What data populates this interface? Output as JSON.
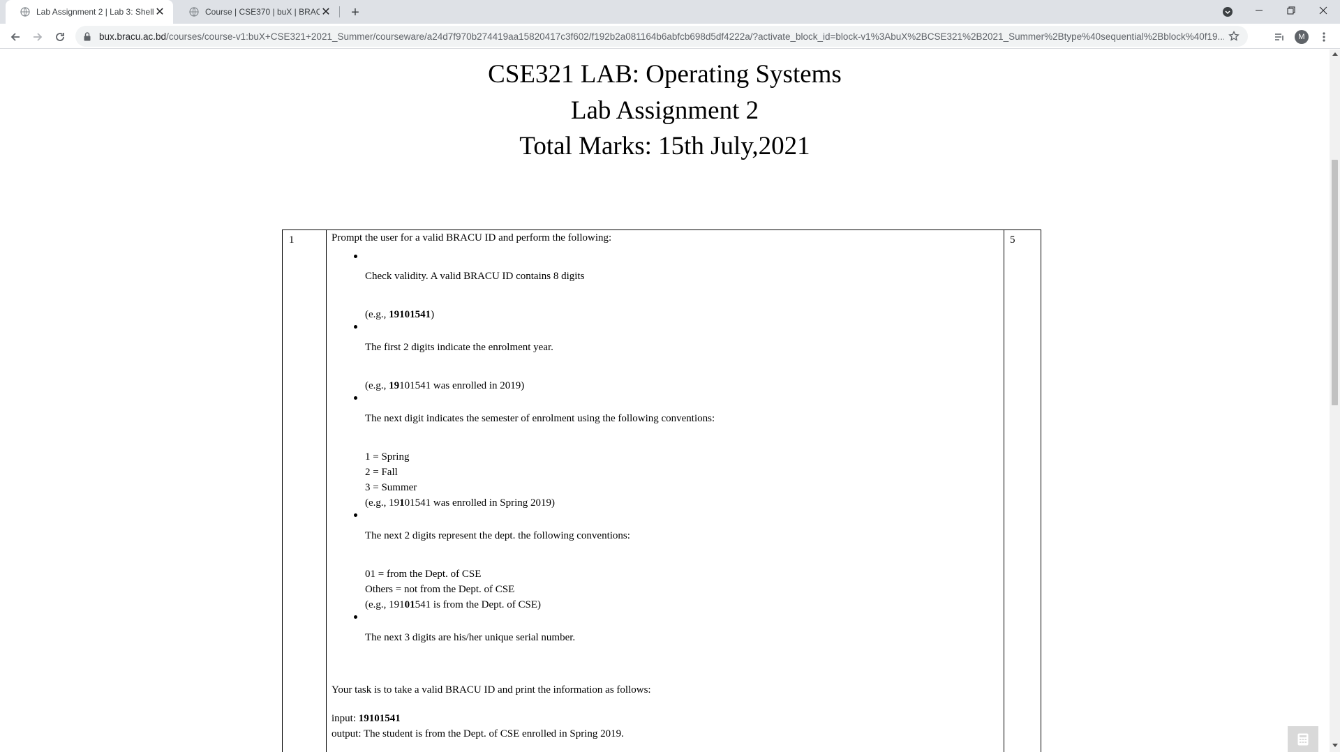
{
  "browser": {
    "tabs": [
      {
        "title": "Lab Assignment 2 | Lab 3: Shell S",
        "active": true
      },
      {
        "title": "Course | CSE370 | buX | BRAC Un",
        "active": false
      }
    ],
    "url_host": "bux.bracu.ac.bd",
    "url_path": "/courses/course-v1:buX+CSE321+2021_Summer/courseware/a24d7f970b274419aa15820417c3f602/f192b2a081164b6abfcb698d5df4222a/?activate_block_id=block-v1%3AbuX%2BCSE321%2B2021_Summer%2Btype%40sequential%2Bblock%40f19...",
    "avatar_letter": "M"
  },
  "document": {
    "title_line1": "CSE321 LAB: Operating Systems",
    "title_line2": "Lab Assignment 2",
    "title_line3": "Total Marks: 15th July,2021"
  },
  "question": {
    "number": "1",
    "marks": "5",
    "prompt": "Prompt the user for a valid BRACU ID and perform the following:",
    "b1_text": "Check validity. A valid BRACU ID contains 8 digits",
    "b1_ex_pre": "(e.g., ",
    "b1_ex_bold": "19101541",
    "b1_ex_post": ")",
    "b2_text": "The first 2 digits indicate the enrolment year.",
    "b2_ex_pre": "(e.g., ",
    "b2_ex_bold": "19",
    "b2_ex_post": "101541 was enrolled in 2019)",
    "b3_text": "The next digit indicates the semester of enrolment using the following conventions:",
    "b3_c1": "1 = Spring",
    "b3_c2": "2 = Fall",
    "b3_c3": "3 = Summer",
    "b3_ex_pre": "(e.g., 19",
    "b3_ex_bold": "1",
    "b3_ex_post": "01541 was enrolled in Spring 2019)",
    "b4_text": "The next 2 digits represent the dept. the following conventions:",
    "b4_c1": "01 = from the Dept. of CSE",
    "b4_c2": "Others = not from the Dept. of CSE",
    "b4_ex_pre": "(e.g., 191",
    "b4_ex_bold": "01",
    "b4_ex_post": "541 is from the Dept. of CSE)",
    "b5_text": "The next 3 digits are his/her unique serial number.",
    "task": "Your task is to take a valid BRACU ID and print the information as follows:",
    "input_label": "input: ",
    "input_value": "19101541",
    "output": "output: The student is from the Dept. of CSE enrolled in Spring 2019."
  },
  "colors": {
    "tabstrip_bg": "#dee1e6",
    "omnibox_bg": "#f1f3f4",
    "text": "#000000"
  }
}
